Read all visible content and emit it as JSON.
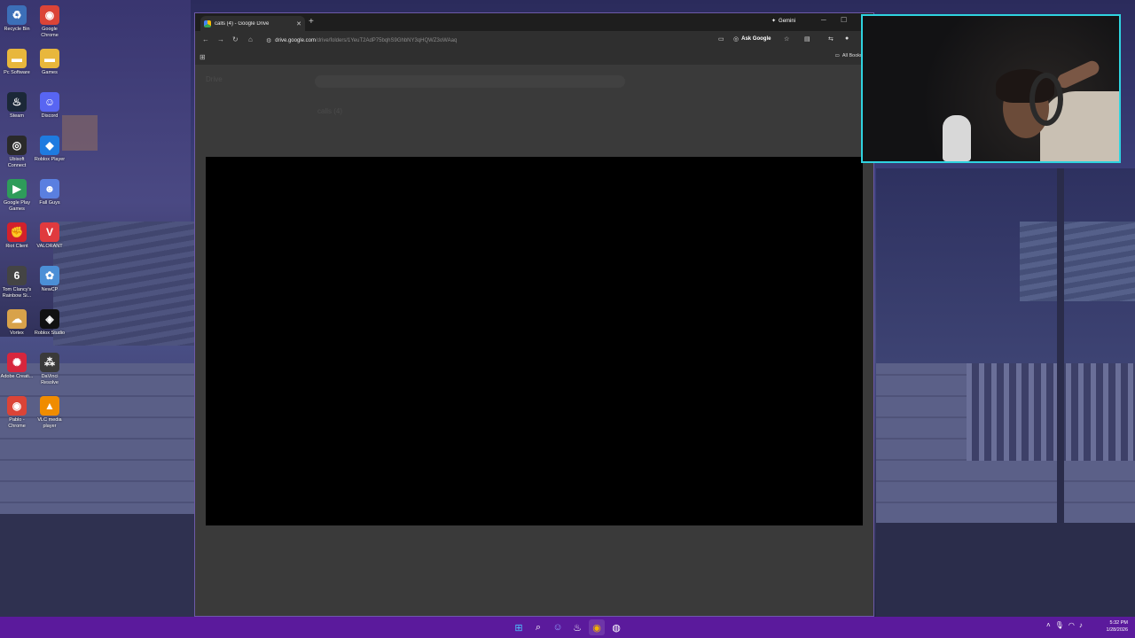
{
  "desktop": {
    "icons": [
      {
        "label": "Recycle Bin",
        "icon": "recycle-bin-icon",
        "glyph": "♻",
        "color": "#3c6fb8"
      },
      {
        "label": "Google Chrome",
        "icon": "chrome-icon",
        "glyph": "◉",
        "color": "#db4437"
      },
      {
        "label": "Pc Software",
        "icon": "folder-icon",
        "glyph": "▬",
        "color": "#e8b73c"
      },
      {
        "label": "Games",
        "icon": "folder-icon",
        "glyph": "▬",
        "color": "#e8b73c"
      },
      {
        "label": "Steam",
        "icon": "steam-icon",
        "glyph": "♨",
        "color": "#1b2838"
      },
      {
        "label": "Discord",
        "icon": "discord-icon",
        "glyph": "☺",
        "color": "#5865f2"
      },
      {
        "label": "Ubisoft Connect",
        "icon": "ubisoft-icon",
        "glyph": "◎",
        "color": "#2a2a2a"
      },
      {
        "label": "Roblox Player",
        "icon": "roblox-player-icon",
        "glyph": "◆",
        "color": "#1e7be0"
      },
      {
        "label": "Google Play Games",
        "icon": "play-games-icon",
        "glyph": "▶",
        "color": "#2e9c5a"
      },
      {
        "label": "Fall Guys",
        "icon": "fall-guys-icon",
        "glyph": "☻",
        "color": "#5a7fe0"
      },
      {
        "label": "Riot Client",
        "icon": "riot-icon",
        "glyph": "✊",
        "color": "#d3212c"
      },
      {
        "label": "VALORANT",
        "icon": "valorant-icon",
        "glyph": "V",
        "color": "#e03a3e"
      },
      {
        "label": "Tom Clancy's Rainbow Si...",
        "icon": "rainbow-six-icon",
        "glyph": "6",
        "color": "#444"
      },
      {
        "label": "NewCP",
        "icon": "newcp-icon",
        "glyph": "✿",
        "color": "#4b8fd6"
      },
      {
        "label": "Vortex",
        "icon": "vortex-icon",
        "glyph": "☁",
        "color": "#d8a24a"
      },
      {
        "label": "Roblox Studio",
        "icon": "roblox-studio-icon",
        "glyph": "◈",
        "color": "#111"
      },
      {
        "label": "Adobe Creati...",
        "icon": "adobe-cc-icon",
        "glyph": "✺",
        "color": "#d7263d"
      },
      {
        "label": "DaVinci Resolve",
        "icon": "davinci-icon",
        "glyph": "⁂",
        "color": "#3a3a3a"
      },
      {
        "label": "Pablo - Chrome",
        "icon": "chrome-profile-icon",
        "glyph": "◉",
        "color": "#db4437"
      },
      {
        "label": "VLC media player",
        "icon": "vlc-icon",
        "glyph": "▲",
        "color": "#f08c00"
      }
    ]
  },
  "browser": {
    "tab_title": "calls (4) - Google Drive",
    "new_tab": "+",
    "gemini_label": "Gemini",
    "url_host": "drive.google.com",
    "url_path": "/drive/folders/1YeuT2AdP75bqhS9GhbNY3qHQWZ3oWAaq",
    "ask_google": "Ask Google",
    "all_bookmarks": "All Bookmarks",
    "page_title_ghost": "Drive",
    "breadcrumb_ghost": "calls (4)"
  },
  "taskbar": {
    "time": "5:32 PM",
    "date": "1/28/2026"
  }
}
